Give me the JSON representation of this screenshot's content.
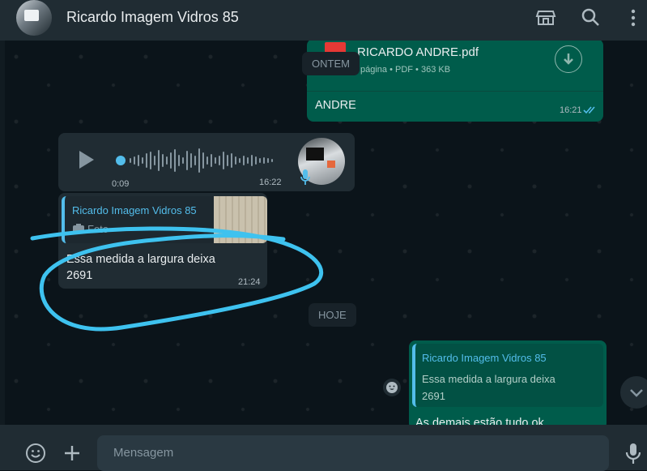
{
  "header": {
    "title": "Ricardo Imagem Vidros 85",
    "icons": [
      "store-icon",
      "search-icon",
      "menu-icon"
    ]
  },
  "messages": {
    "pdf": {
      "filename": "RICARDO ANDRE.pdf",
      "info": "página • PDF • 363 KB",
      "caption": "ANDRE",
      "time": "16:21"
    },
    "date_yesterday": "ONTEM",
    "audio": {
      "elapsed": "0:09",
      "time": "16:22"
    },
    "reply": {
      "quoted_name": "Ricardo Imagem Vidros 85",
      "quoted_type": "Foto",
      "text": "Essa medida a largura deixa 2691",
      "time": "21:24"
    },
    "date_today": "HOJE",
    "outgoing_reply": {
      "quoted_name": "Ricardo Imagem Vidros 85",
      "quoted_text": "Essa medida a largura deixa 2691",
      "text": "As demais estão tudo ok"
    }
  },
  "footer": {
    "placeholder": "Mensagem"
  },
  "colors": {
    "header_bg": "#202c33",
    "chat_bg": "#0b141a",
    "outgoing_bubble": "#005c4b",
    "incoming_bubble": "#202c33",
    "accent_blue": "#53bdeb",
    "annotation": "#3ec2ef"
  }
}
